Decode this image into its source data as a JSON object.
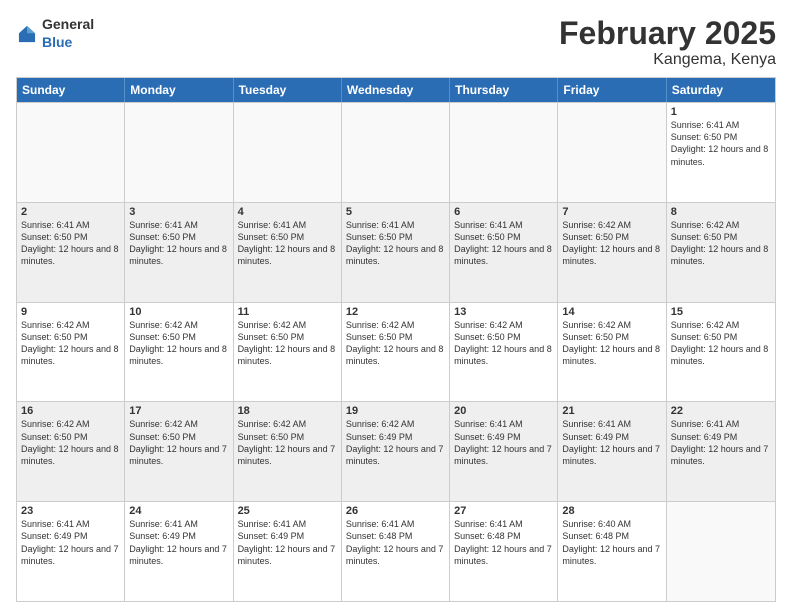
{
  "logo": {
    "general": "General",
    "blue": "Blue"
  },
  "title": "February 2025",
  "subtitle": "Kangema, Kenya",
  "days": [
    "Sunday",
    "Monday",
    "Tuesday",
    "Wednesday",
    "Thursday",
    "Friday",
    "Saturday"
  ],
  "weeks": [
    [
      {
        "day": "",
        "info": ""
      },
      {
        "day": "",
        "info": ""
      },
      {
        "day": "",
        "info": ""
      },
      {
        "day": "",
        "info": ""
      },
      {
        "day": "",
        "info": ""
      },
      {
        "day": "",
        "info": ""
      },
      {
        "day": "1",
        "info": "Sunrise: 6:41 AM\nSunset: 6:50 PM\nDaylight: 12 hours and 8 minutes."
      }
    ],
    [
      {
        "day": "2",
        "info": "Sunrise: 6:41 AM\nSunset: 6:50 PM\nDaylight: 12 hours and 8 minutes."
      },
      {
        "day": "3",
        "info": "Sunrise: 6:41 AM\nSunset: 6:50 PM\nDaylight: 12 hours and 8 minutes."
      },
      {
        "day": "4",
        "info": "Sunrise: 6:41 AM\nSunset: 6:50 PM\nDaylight: 12 hours and 8 minutes."
      },
      {
        "day": "5",
        "info": "Sunrise: 6:41 AM\nSunset: 6:50 PM\nDaylight: 12 hours and 8 minutes."
      },
      {
        "day": "6",
        "info": "Sunrise: 6:41 AM\nSunset: 6:50 PM\nDaylight: 12 hours and 8 minutes."
      },
      {
        "day": "7",
        "info": "Sunrise: 6:42 AM\nSunset: 6:50 PM\nDaylight: 12 hours and 8 minutes."
      },
      {
        "day": "8",
        "info": "Sunrise: 6:42 AM\nSunset: 6:50 PM\nDaylight: 12 hours and 8 minutes."
      }
    ],
    [
      {
        "day": "9",
        "info": "Sunrise: 6:42 AM\nSunset: 6:50 PM\nDaylight: 12 hours and 8 minutes."
      },
      {
        "day": "10",
        "info": "Sunrise: 6:42 AM\nSunset: 6:50 PM\nDaylight: 12 hours and 8 minutes."
      },
      {
        "day": "11",
        "info": "Sunrise: 6:42 AM\nSunset: 6:50 PM\nDaylight: 12 hours and 8 minutes."
      },
      {
        "day": "12",
        "info": "Sunrise: 6:42 AM\nSunset: 6:50 PM\nDaylight: 12 hours and 8 minutes."
      },
      {
        "day": "13",
        "info": "Sunrise: 6:42 AM\nSunset: 6:50 PM\nDaylight: 12 hours and 8 minutes."
      },
      {
        "day": "14",
        "info": "Sunrise: 6:42 AM\nSunset: 6:50 PM\nDaylight: 12 hours and 8 minutes."
      },
      {
        "day": "15",
        "info": "Sunrise: 6:42 AM\nSunset: 6:50 PM\nDaylight: 12 hours and 8 minutes."
      }
    ],
    [
      {
        "day": "16",
        "info": "Sunrise: 6:42 AM\nSunset: 6:50 PM\nDaylight: 12 hours and 8 minutes."
      },
      {
        "day": "17",
        "info": "Sunrise: 6:42 AM\nSunset: 6:50 PM\nDaylight: 12 hours and 7 minutes."
      },
      {
        "day": "18",
        "info": "Sunrise: 6:42 AM\nSunset: 6:50 PM\nDaylight: 12 hours and 7 minutes."
      },
      {
        "day": "19",
        "info": "Sunrise: 6:42 AM\nSunset: 6:49 PM\nDaylight: 12 hours and 7 minutes."
      },
      {
        "day": "20",
        "info": "Sunrise: 6:41 AM\nSunset: 6:49 PM\nDaylight: 12 hours and 7 minutes."
      },
      {
        "day": "21",
        "info": "Sunrise: 6:41 AM\nSunset: 6:49 PM\nDaylight: 12 hours and 7 minutes."
      },
      {
        "day": "22",
        "info": "Sunrise: 6:41 AM\nSunset: 6:49 PM\nDaylight: 12 hours and 7 minutes."
      }
    ],
    [
      {
        "day": "23",
        "info": "Sunrise: 6:41 AM\nSunset: 6:49 PM\nDaylight: 12 hours and 7 minutes."
      },
      {
        "day": "24",
        "info": "Sunrise: 6:41 AM\nSunset: 6:49 PM\nDaylight: 12 hours and 7 minutes."
      },
      {
        "day": "25",
        "info": "Sunrise: 6:41 AM\nSunset: 6:49 PM\nDaylight: 12 hours and 7 minutes."
      },
      {
        "day": "26",
        "info": "Sunrise: 6:41 AM\nSunset: 6:48 PM\nDaylight: 12 hours and 7 minutes."
      },
      {
        "day": "27",
        "info": "Sunrise: 6:41 AM\nSunset: 6:48 PM\nDaylight: 12 hours and 7 minutes."
      },
      {
        "day": "28",
        "info": "Sunrise: 6:40 AM\nSunset: 6:48 PM\nDaylight: 12 hours and 7 minutes."
      },
      {
        "day": "",
        "info": ""
      }
    ]
  ]
}
